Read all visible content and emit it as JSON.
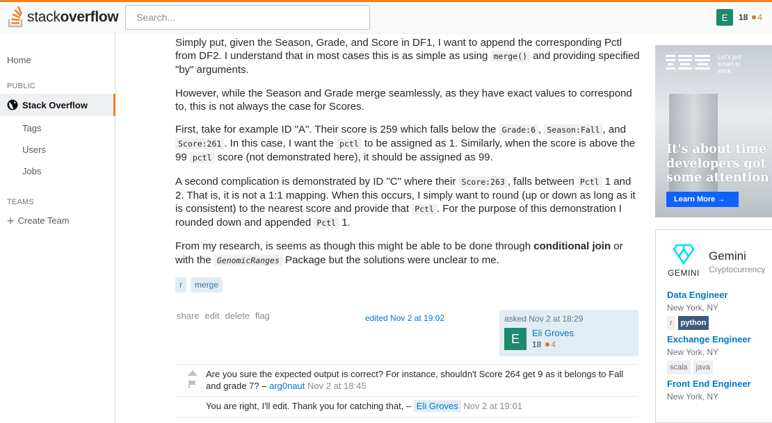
{
  "header": {
    "logo_light": "stack",
    "logo_bold": "overflow",
    "search_placeholder": "Search...",
    "user_initial": "E",
    "reputation": "18",
    "bronze_badges": "4"
  },
  "sidebar": {
    "home": "Home",
    "public_label": "PUBLIC",
    "stack_overflow": "Stack Overflow",
    "tags": "Tags",
    "users": "Users",
    "jobs": "Jobs",
    "teams_label": "TEAMS",
    "create_team": "Create Team"
  },
  "question": {
    "p1": {
      "t1": "Simply put, given the Season, Grade, and Score in DF1, I want to append the corresponding Pctl from DF2. I understand that in most cases this is as simple as using ",
      "c1": "merge()",
      "t2": " and providing specified \"by\" arguments."
    },
    "p2": {
      "t1": "However, while the Season and Grade merge seamlessly, as they have exact values to correspond to, this is not always the case for Scores."
    },
    "p3": {
      "t1": "First, take for example ID \"A\". Their score is 259 which falls below the ",
      "c1": "Grade:6",
      "t2": ", ",
      "c2": "Season:Fall",
      "t3": ", and ",
      "c3": "Score:261",
      "t4": ". In this case, I want the ",
      "c4": "pctl",
      "t5": " to be assigned as 1. Similarly, when the score is above the 99 ",
      "c5": "pctl",
      "t6": " score (not demonstrated here), it should be assigned as 99."
    },
    "p4": {
      "t1": "A second complication is demonstrated by ID \"C\" where their ",
      "c1": "Score:263",
      "t2": ", falls between ",
      "c2": "Pctl",
      "t3": " 1 and 2. That is, it is not a 1:1 mapping. When this occurs, I simply want to round (up or down as long as it is consistent) to the nearest score and provide that ",
      "c3": "Pctl",
      "t4": ". For the purpose of this demonstration I rounded down and appended ",
      "c4": "Pctl",
      "t5": " 1."
    },
    "p5": {
      "t1": "From my research, is seems as though this might be able to be done through ",
      "b1": "conditional join",
      "t2": " or with the ",
      "c1": "GenomicRanges",
      "t3": " Package but the solutions were unclear to me."
    },
    "tags": [
      "r",
      "merge"
    ],
    "menu": [
      "share",
      "edit",
      "delete",
      "flag"
    ],
    "edited": "edited Nov 2 at 19:02",
    "asked": "asked Nov 2 at 18:29",
    "owner_initial": "E",
    "owner_name": "Eli Groves",
    "owner_rep": "18",
    "owner_bronze": "4"
  },
  "comments": [
    {
      "text": "Are you sure the expected output is correct? For instance, shouldn't Score 264 get 9 as it belongs to Fall and grade 7? – ",
      "user": "arg0naut",
      "date": "Nov 2 at 18:45"
    },
    {
      "text": "You are right, I'll edit. Thank you for catching that, – ",
      "user": "Eli Groves",
      "date": "Nov 2 at 19:01"
    }
  ],
  "ad": {
    "brand": "IBM",
    "tagline": "Let's put smart to work.",
    "headline_1": "It's about time",
    "headline_2": "developers got",
    "headline_3": "some attention",
    "cta": "Learn More →"
  },
  "jobs_panel": {
    "company_logo_word": "GEMINI",
    "company_name": "Gemini",
    "company_sub": "Cryptocurrency",
    "jobs": [
      {
        "title": "Data Engineer",
        "location": "New York, NY",
        "tags": [
          "r",
          "python"
        ]
      },
      {
        "title": "Exchange Engineer",
        "location": "New York, NY",
        "tags": [
          "scala",
          "java"
        ]
      },
      {
        "title": "Front End Engineer",
        "location": "New York, NY",
        "tags": []
      }
    ]
  },
  "colors": {
    "accent": "#f48024",
    "link": "#0077cc",
    "tag_bg": "#e1ecf4",
    "avatar": "#1d8a6e"
  }
}
